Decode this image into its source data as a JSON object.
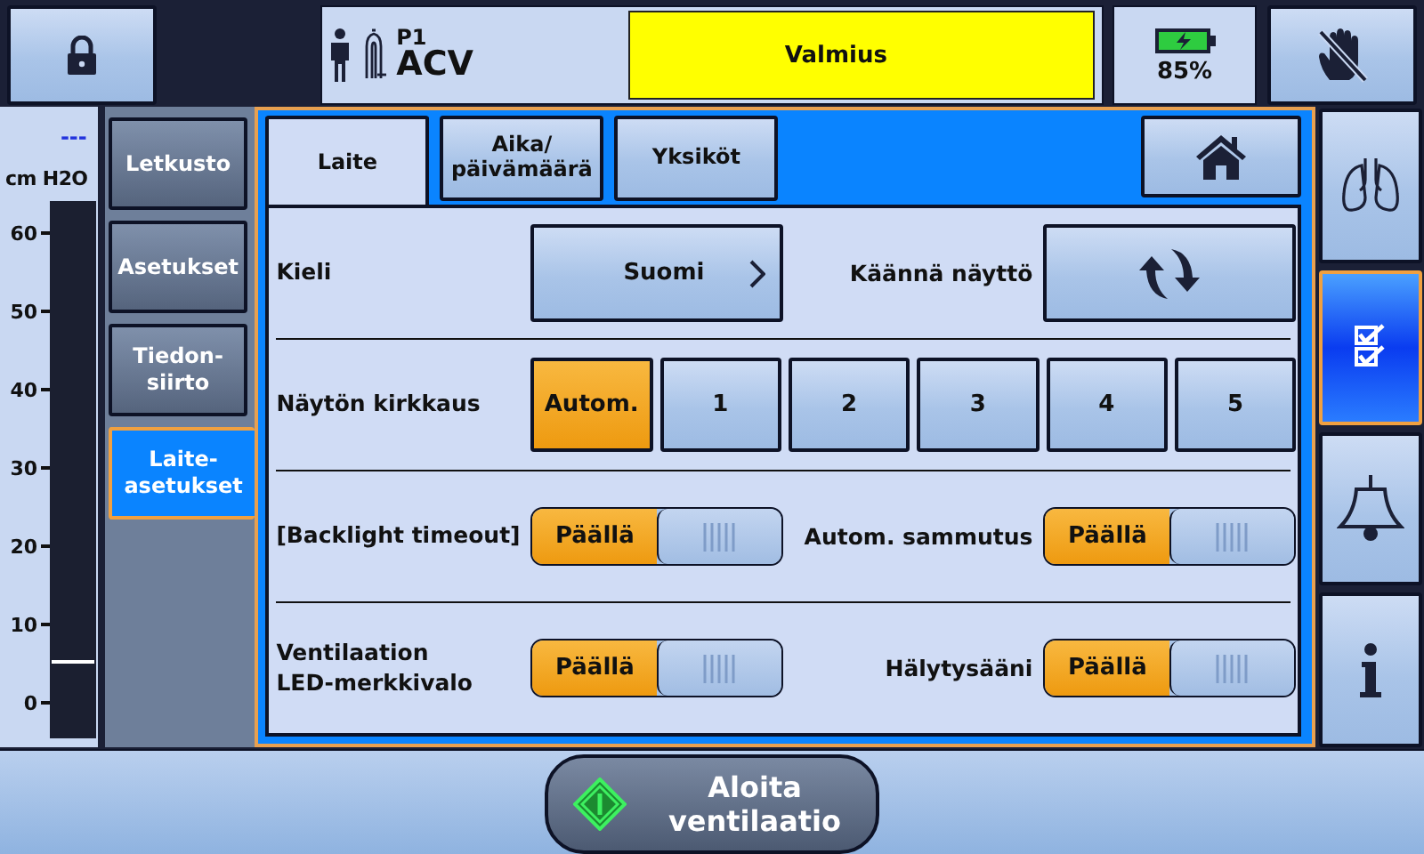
{
  "top_bar": {
    "patient": {
      "id": "P1",
      "mode": "ACV"
    },
    "status": "Valmius",
    "battery": {
      "percent": "85%",
      "charging": true
    }
  },
  "pressure_gauge": {
    "reading": "---",
    "unit": "cm H2O",
    "ticks": [
      "60",
      "50",
      "40",
      "30",
      "20",
      "10",
      "0"
    ],
    "level": 0.14
  },
  "side_tabs": [
    {
      "label": "Letkusto",
      "selected": false
    },
    {
      "label": "Asetukset",
      "selected": false
    },
    {
      "label": "Tiedon-\nsiirto",
      "selected": false
    },
    {
      "label": "Laite-\nasetukset",
      "selected": true
    }
  ],
  "tabs": [
    {
      "label": "Laite",
      "selected": true
    },
    {
      "label": "Aika/\npäivämäärä",
      "selected": false
    },
    {
      "label": "Yksiköt",
      "selected": false
    }
  ],
  "settings": {
    "language": {
      "label": "Kieli",
      "value": "Suomi"
    },
    "rotate": {
      "label": "Käännä näyttö"
    },
    "brightness": {
      "label": "Näytön kirkkaus",
      "options": [
        {
          "label": "Autom.",
          "selected": true
        },
        {
          "label": "1",
          "selected": false
        },
        {
          "label": "2",
          "selected": false
        },
        {
          "label": "3",
          "selected": false
        },
        {
          "label": "4",
          "selected": false
        },
        {
          "label": "5",
          "selected": false
        }
      ]
    },
    "toggles": [
      {
        "label": "[Backlight timeout]",
        "value": "Päällä",
        "on": true
      },
      {
        "label": "Autom. sammutus",
        "value": "Päällä",
        "on": true
      },
      {
        "label": "Ventilaation\nLED-merkkivalo",
        "value": "Päällä",
        "on": true
      },
      {
        "label": "Hälytysääni",
        "value": "Päällä",
        "on": true
      }
    ]
  },
  "rail": [
    {
      "kind": "lungs",
      "selected": false
    },
    {
      "kind": "checklist",
      "selected": true
    },
    {
      "kind": "alarm",
      "selected": false
    },
    {
      "kind": "info",
      "selected": false
    }
  ],
  "start_button": {
    "label": "Aloita\nventilaatio"
  }
}
